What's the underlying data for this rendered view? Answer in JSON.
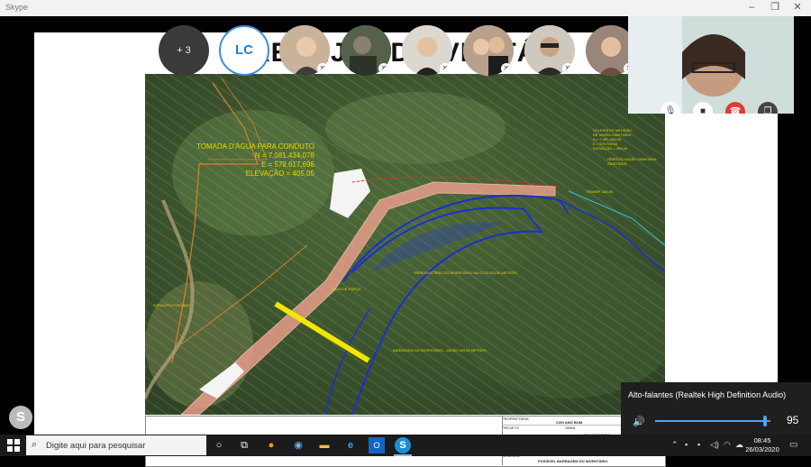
{
  "window": {
    "app_name": "Skype",
    "controls": {
      "minimize": "–",
      "maximize": "❐",
      "close": "✕"
    }
  },
  "slide": {
    "title": "REBNJOODO  VERTÁR",
    "map": {
      "tomada_lines": [
        "TOMADA D'ÁGUA PARA CONDUTO",
        "N = 7.081.434,078",
        "E = 579.617,696",
        "ELEVAÇÃO = 405,05"
      ],
      "labels": {
        "rio": "RESERVATÓRIO DO INVENTÁRIO NA COTA 403,00 METROS",
        "barragem": "BARRAGEM DO INVENTÁRIO - VAZÃO 403,00 METROS",
        "left_small": "CONDUTO FORÇADO",
        "casa": "CASA DE FORÇA",
        "soleira": [
          "SOLEIRA DE MEDIÇÃO",
          "DE VAZÃO SANITÁRIA",
          "N = 7.081.444,45",
          "E = 579.739,83",
          "ELEVAÇÃO = 408,00"
        ],
        "orificio": [
          "ORIFÍCIO VAZÃO SANITÁRIA",
          "SANITÁRIA"
        ],
        "ponto": "TRANSP. 406,00"
      }
    },
    "info_block": {
      "proprietario_label": "PROPRIETÁRIA",
      "proprietario_value": "CGH ANO BOM",
      "projeto_label": "PROJETO",
      "obra_label": "OBRA",
      "obra_value": "CGH ANO BOM",
      "titulo_label": "TÍTULO",
      "desenho_label": "DESENHO",
      "desenho_value": "POSSÍVEL BARRAGEM DO INVENTÁRIO"
    }
  },
  "call": {
    "participants": [
      {
        "type": "more",
        "label": "+ 3"
      },
      {
        "type": "initials",
        "label": "LC"
      },
      {
        "type": "photo"
      },
      {
        "type": "photo"
      },
      {
        "type": "photo"
      },
      {
        "type": "photo"
      },
      {
        "type": "photo"
      },
      {
        "type": "photo"
      }
    ],
    "controls": {
      "mic": "mic-icon",
      "video": "video-icon",
      "end": "end-call-icon",
      "switch": "switch-icon"
    }
  },
  "volume_flyout": {
    "device": "Alto-falantes (Realtek High Definition Audio)",
    "level": 95
  },
  "taskbar": {
    "search_placeholder": "Digite aqui para pesquisar",
    "time": "08:45",
    "date": "26/03/2020"
  },
  "colors": {
    "accent": "#4aa3ff",
    "end_call": "#e23b2e",
    "map_label": "#e8d800",
    "dam_line": "#f2e600"
  }
}
